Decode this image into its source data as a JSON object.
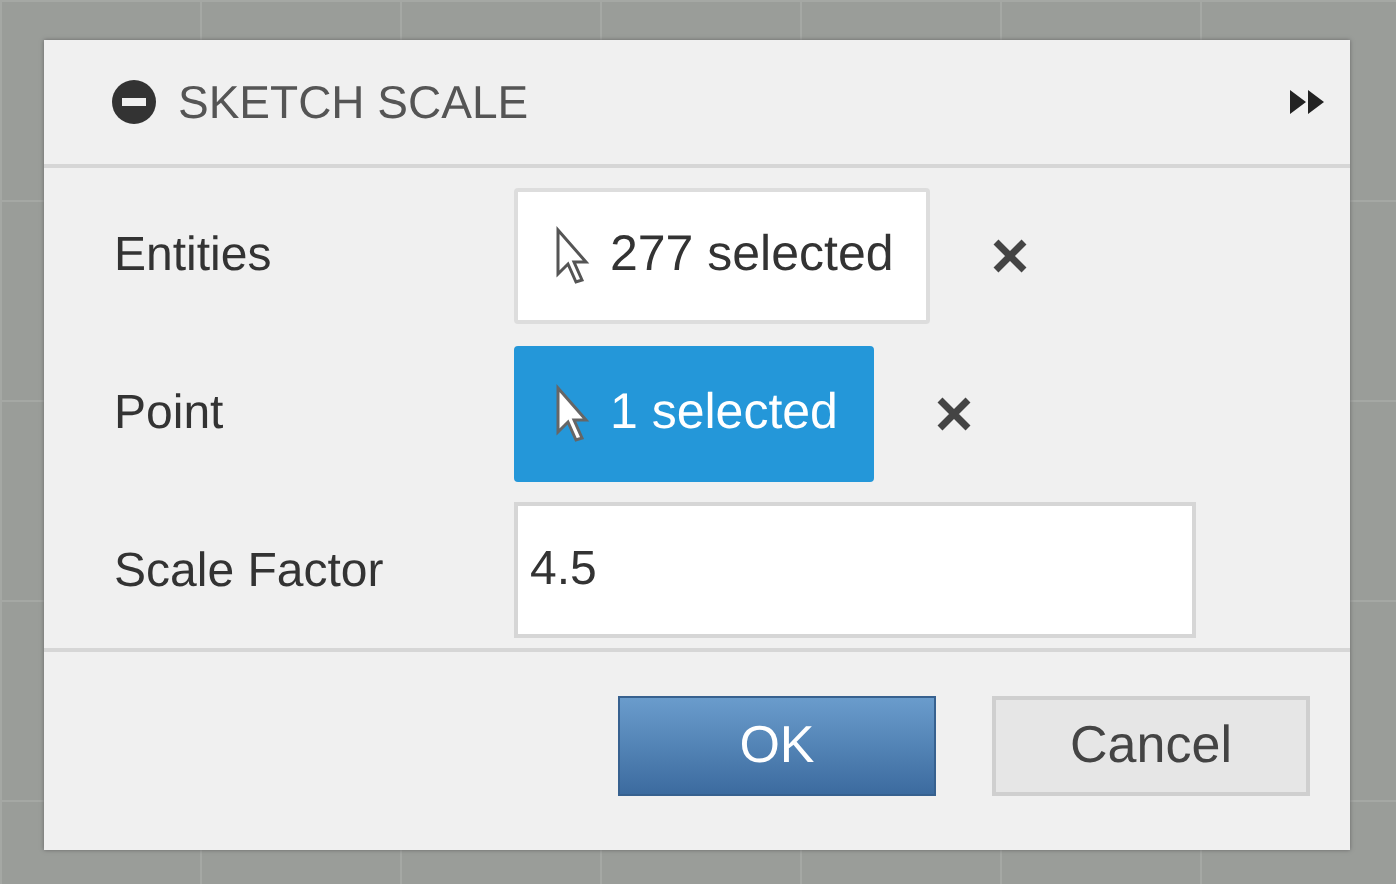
{
  "dialog": {
    "title": "SKETCH SCALE"
  },
  "rows": [
    {
      "kind": "selection",
      "label": "Entities",
      "value": "277 selected",
      "selected": false
    },
    {
      "kind": "selection",
      "label": "Point",
      "value": "1 selected",
      "selected": true
    },
    {
      "kind": "number",
      "label": "Scale Factor",
      "value": "4.5"
    }
  ],
  "buttons": [
    {
      "kind": "primary",
      "label": "OK"
    },
    {
      "kind": "secondary",
      "label": "Cancel"
    }
  ]
}
